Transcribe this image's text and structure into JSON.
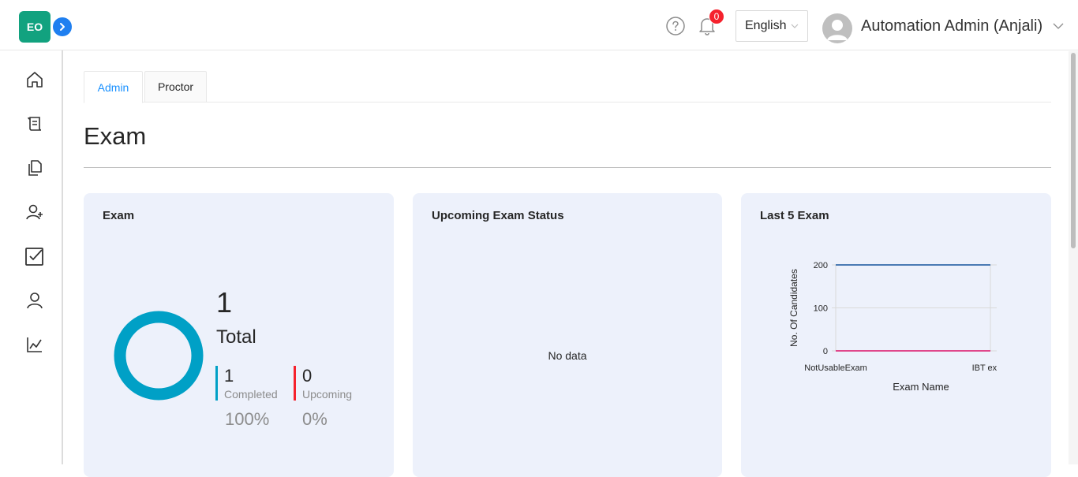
{
  "header": {
    "logo_text": "EO",
    "notification_count": "0",
    "language": "English",
    "user_name": "Automation Admin (Anjali)"
  },
  "sidebar": {
    "items": [
      {
        "icon": "home-icon"
      },
      {
        "icon": "scroll-icon"
      },
      {
        "icon": "documents-icon"
      },
      {
        "icon": "add-user-icon"
      },
      {
        "icon": "checkbox-icon"
      },
      {
        "icon": "user-icon"
      },
      {
        "icon": "chart-icon"
      }
    ]
  },
  "tabs": [
    {
      "label": "Admin",
      "active": true
    },
    {
      "label": "Proctor",
      "active": false
    }
  ],
  "page": {
    "title": "Exam"
  },
  "cards": {
    "exam": {
      "title": "Exam",
      "total_value": "1",
      "total_label": "Total",
      "completed_value": "1",
      "completed_label": "Completed",
      "completed_percent": "100%",
      "upcoming_value": "0",
      "upcoming_label": "Upcoming",
      "upcoming_percent": "0%",
      "completed_color": "#00a0c6",
      "upcoming_color": "#f5222d"
    },
    "upcoming_status": {
      "title": "Upcoming Exam Status",
      "empty_text": "No data"
    },
    "last5": {
      "title": "Last 5 Exam"
    }
  },
  "chart_data": {
    "type": "line",
    "title": "",
    "xlabel": "Exam Name",
    "ylabel": "No. Of Candidates",
    "categories": [
      "NotUsableExam",
      "IBT exam"
    ],
    "y_ticks": [
      0,
      100,
      200
    ],
    "ylim": [
      0,
      200
    ],
    "series": [
      {
        "values": [
          200,
          200
        ],
        "color": "#4a7ab3"
      },
      {
        "values": [
          0,
          0
        ],
        "color": "#e0478b"
      }
    ],
    "grid": true
  }
}
